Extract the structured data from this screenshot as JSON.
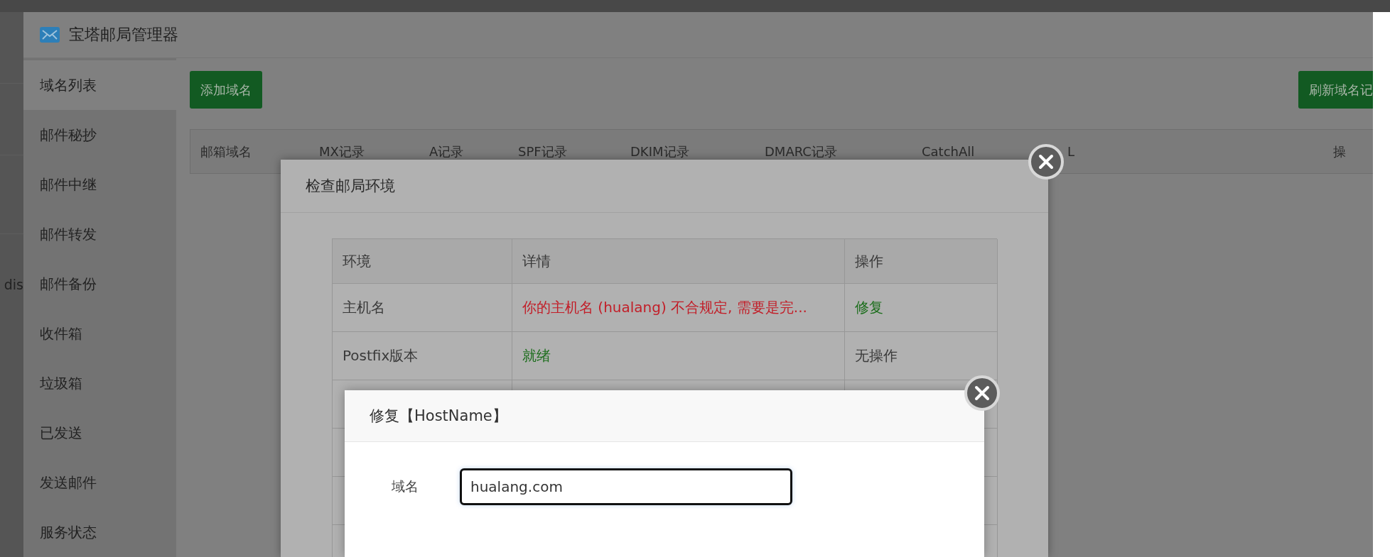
{
  "backdrop": {
    "text": "dis"
  },
  "window": {
    "title": "宝塔邮局管理器"
  },
  "sidebar": {
    "items": [
      {
        "label": "域名列表",
        "selected": true
      },
      {
        "label": "邮件秘抄",
        "selected": false
      },
      {
        "label": "邮件中继",
        "selected": false
      },
      {
        "label": "邮件转发",
        "selected": false
      },
      {
        "label": "邮件备份",
        "selected": false
      },
      {
        "label": "收件箱",
        "selected": false
      },
      {
        "label": "垃圾箱",
        "selected": false
      },
      {
        "label": "已发送",
        "selected": false
      },
      {
        "label": "发送邮件",
        "selected": false
      },
      {
        "label": "服务状态",
        "selected": false
      }
    ]
  },
  "toolbar": {
    "add_button": "添加域名",
    "refresh_button": "刷新域名记"
  },
  "table": {
    "columns": [
      "邮箱域名",
      "MX记录",
      "A记录",
      "SPF记录",
      "DKIM记录",
      "DMARC记录",
      "CatchAll",
      "L",
      "操"
    ]
  },
  "check_dialog": {
    "title": "检查邮局环境",
    "columns": [
      "环境",
      "详情",
      "操作"
    ],
    "rows": [
      {
        "name": "主机名",
        "detail": "你的主机名 (hualang) 不合规定, 需要是完...",
        "color": "#c21e28",
        "action": {
          "kind": "link",
          "text": "修复"
        }
      },
      {
        "name": "Postfix版本",
        "detail": "就绪",
        "color": "#1d6e1d",
        "action": {
          "kind": "plain",
          "text": "无操作"
        }
      }
    ]
  },
  "fix_dialog": {
    "title": "修复【HostName】",
    "fields": [
      {
        "label": "域名",
        "value": "hualang.com"
      }
    ]
  }
}
